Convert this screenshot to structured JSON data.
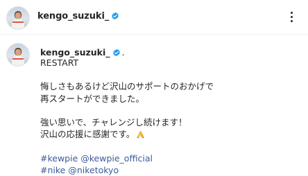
{
  "header": {
    "username": "kengo_suzuki_",
    "verified_icon": "verified-badge-icon",
    "more_icon": "more-horizontal-icon"
  },
  "caption": {
    "username": "kengo_suzuki_",
    "separator": ".",
    "lines": [
      "RESTART",
      "",
      "悔しさもあるけど沢山のサポートのおかげで",
      "再スタートができました。",
      "",
      "強い思いで、チャレンジし続けます！",
      "沢山の応援に感謝です。"
    ],
    "emoji": "folded-hands-icon",
    "hashtag_line_1": "#kewpie @kewpie_official",
    "hashtag_line_2": "#nike @niketokyo"
  },
  "colors": {
    "verified": "#1d9bf0",
    "link": "#3b5a9a",
    "text": "#262626"
  }
}
